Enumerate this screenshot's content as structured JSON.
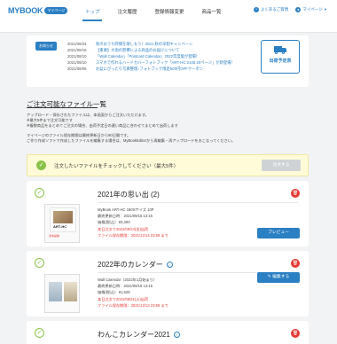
{
  "header": {
    "logo": "MYBOOK",
    "logo_sub": "マイページ",
    "nav": [
      "トップ",
      "注文履歴",
      "登録情報変更",
      "商品一覧"
    ],
    "faq": "よくあるご質問",
    "mypage": "マイページ",
    "accent": "#2b7fc3"
  },
  "notice": {
    "badge": "お知らせ",
    "items": [
      {
        "date": "2021/08/24",
        "text": "秋のおうち時間を楽しもう！2021 秋の早割キャンペーン"
      },
      {
        "date": "2021/08/16",
        "text": "【重要】大雨の影響による商品のお届けについて"
      },
      {
        "date": "2021/08/10",
        "text": "「Wall Calendar」「Postcard Calendar」2022年度版が登場！"
      },
      {
        "date": "2021/08/10",
        "text": "スマホで作れるハードカバーフォトブック「ART-HC 2105 20ページ」が新登場！"
      },
      {
        "date": "2021/08/06",
        "text": "お盆にぴったり写真整理♪フォトブック限定500円OFFクーポン"
      }
    ],
    "ship_label": "出荷予定表"
  },
  "section": {
    "title": "ご注文可能なファイル一覧",
    "desc": [
      "アップロード・保存されたファイルは、本画面からご注文いただけます。",
      "※最大5件まで注文可能です",
      "※複数商品をまとめてご注文の場合、出荷予定日の遅い商品に合わせてまとめて出荷します",
      "",
      "マイページのファイル保存期間は最終更新日から90日間です。",
      "ご作り作成ソフトで作成したファイルを編集する場合は、MyBookEditorから再編集・再アップロードをおこなってください。"
    ]
  },
  "select_bar": {
    "text": "注文したいファイルをチェックしてください（最大5件）",
    "cart_button": "注文する"
  },
  "cards": [
    {
      "title": "2021年の思い出 (2)",
      "thumb_title": "ART-HC",
      "thumb_caption": "見本画像",
      "lines": [
        "MyBook ART-HC 180Sサイズ 10P",
        "最終更新日時：2021/09/15 13:15",
        "価格(税込)：¥3,300",
        "本日注文で2021/09/24(金)出荷",
        "ファイル保存期限：2021/12/14 23:59 まで"
      ],
      "action": "プレビュー"
    },
    {
      "title": "2022年のカレンダー",
      "lines": [
        "Wall Calendar（2022年1月始まり）",
        "最終更新日時：2021/09/15 13:15",
        "価格(税込)：¥1,628",
        "本日注文で2021/09/21(火)出荷",
        "ファイル保存期限：2021/12/13 23:59 まで"
      ],
      "action": "編集する"
    },
    {
      "title": "わんこカレンダー2021",
      "lines": []
    }
  ]
}
